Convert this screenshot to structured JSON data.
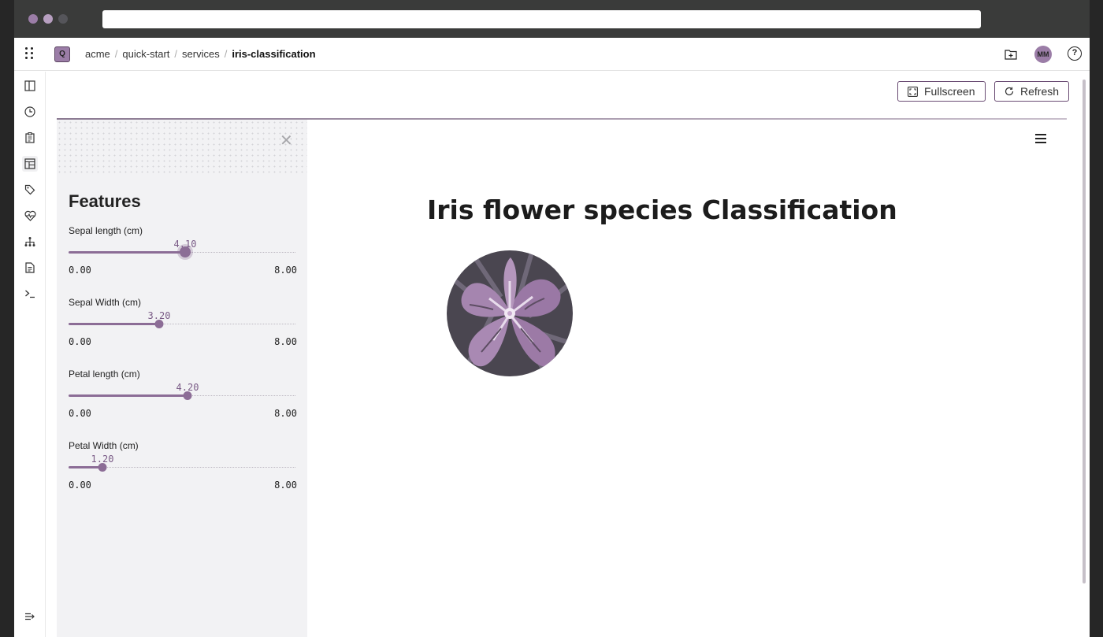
{
  "breadcrumb": {
    "items": [
      "acme",
      "quick-start",
      "services",
      "iris-classification"
    ]
  },
  "project_badge": "Q",
  "user_initials": "MM",
  "help_glyph": "?",
  "toolbar": {
    "fullscreen_label": "Fullscreen",
    "refresh_label": "Refresh"
  },
  "sidebar": {
    "title": "Features",
    "close_glyph": "✕",
    "sliders": [
      {
        "label": "Sepal length (cm)",
        "value": "4.10",
        "min": "0.00",
        "max": "8.00",
        "fraction": 0.5125
      },
      {
        "label": "Sepal Width (cm)",
        "value": "3.20",
        "min": "0.00",
        "max": "8.00",
        "fraction": 0.4
      },
      {
        "label": "Petal length (cm)",
        "value": "4.20",
        "min": "0.00",
        "max": "8.00",
        "fraction": 0.525
      },
      {
        "label": "Petal Width (cm)",
        "value": "1.20",
        "min": "0.00",
        "max": "8.00",
        "fraction": 0.15
      }
    ]
  },
  "main": {
    "title": "Iris flower species Classification"
  },
  "colors": {
    "accent": "#8c6d96",
    "brand_dark": "#6b4d74",
    "chrome": "#3a3b3a"
  },
  "icons": {
    "rail": [
      "panel-icon",
      "clock-icon",
      "clipboard-icon",
      "layout-icon",
      "tags-icon",
      "heart-monitor-icon",
      "hierarchy-icon",
      "document-icon",
      "terminal-icon"
    ],
    "rail_bottom": "expand-icon",
    "topbar": [
      "apps-grid-icon",
      "folder-add-icon",
      "help-icon"
    ],
    "buttons": [
      "fullscreen-icon",
      "refresh-icon"
    ]
  }
}
